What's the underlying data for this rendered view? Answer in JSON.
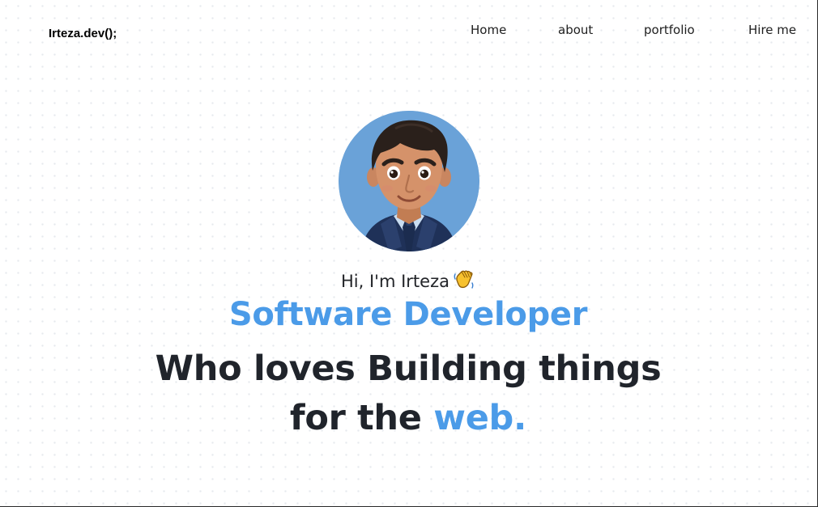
{
  "brand": {
    "logo_text": "Irteza.dev();"
  },
  "nav": {
    "items": [
      {
        "label": "Home"
      },
      {
        "label": "about"
      },
      {
        "label": "portfolio"
      },
      {
        "label": "Hire me"
      }
    ]
  },
  "hero": {
    "avatar_icon": "memoji-avatar-icon",
    "greeting": "Hi, I'm Irteza",
    "greeting_icon": "waving-hand-icon",
    "role": "Software Developer",
    "tagline_line1": "Who loves Building things",
    "tagline_line2_prefix": "for the",
    "tagline_line2_highlight": "web."
  },
  "colors": {
    "accent": "#4b9be8",
    "text_dark": "#20242b",
    "avatar_bg": "#6aa2d8"
  }
}
